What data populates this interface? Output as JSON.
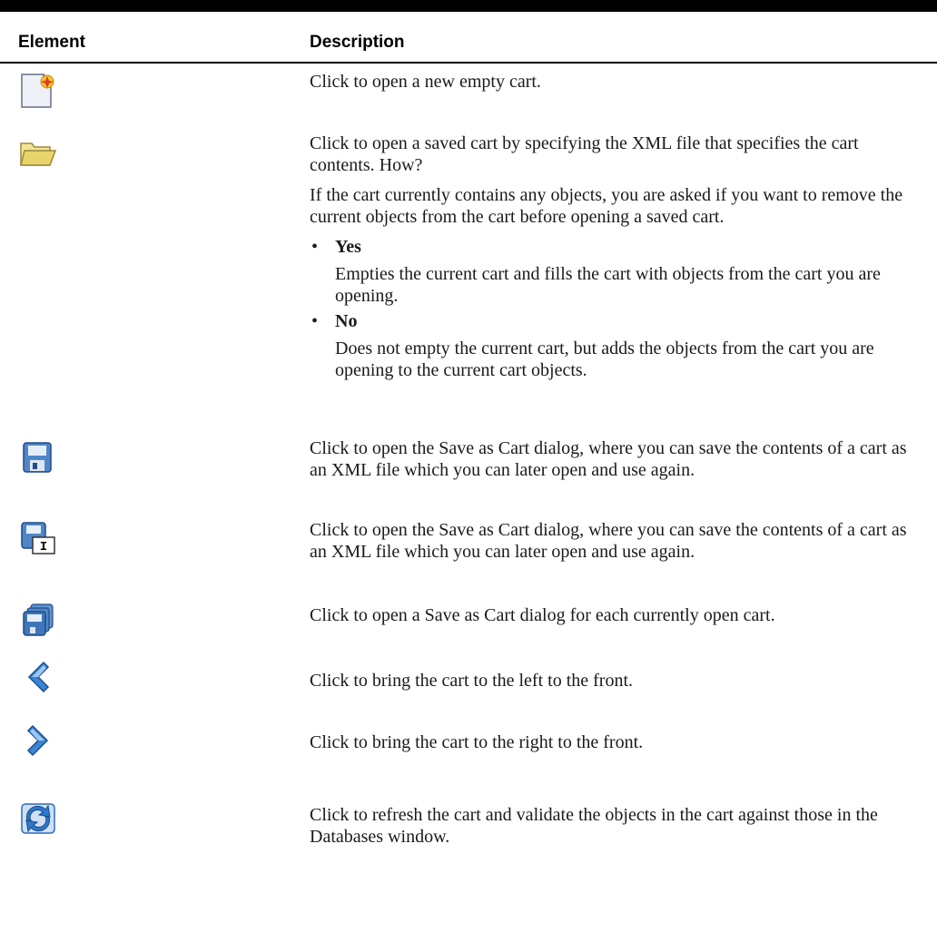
{
  "table": {
    "header": {
      "element": "Element",
      "description": "Description"
    },
    "rows": [
      {
        "icon": "new-cart-icon",
        "text": [
          "Click to open a new empty cart."
        ]
      },
      {
        "icon": "open-folder-icon",
        "text": [
          "Click to open a saved cart by specifying the XML file that specifies the cart contents. How?",
          "If the cart currently contains any objects, you are asked if you want to remove the current objects from the cart before opening a saved cart."
        ],
        "options": [
          {
            "term": "Yes",
            "desc": "Empties the current cart and fills the cart with objects from the cart you are opening."
          },
          {
            "term": "No",
            "desc": "Does not empty the current cart, but adds the objects from the cart you are opening to the current cart objects."
          }
        ]
      },
      {
        "icon": "save-icon",
        "text": [
          "Click to open the Save as Cart dialog, where you can save the contents of a cart as an XML file which you can later open and use again."
        ]
      },
      {
        "icon": "save-as-icon",
        "text": [
          "Click to open the Save as Cart dialog, where you can save the contents of a cart as an XML file which you can later open and use again."
        ]
      },
      {
        "icon": "save-all-icon",
        "text": [
          "Click to open a Save as Cart dialog for each currently open cart."
        ]
      },
      {
        "icon": "chevron-left-icon",
        "text": [
          "Click to bring the cart to the left to the front."
        ]
      },
      {
        "icon": "chevron-right-icon",
        "text": [
          "Click to bring the cart to the right to the front."
        ]
      },
      {
        "icon": "refresh-icon",
        "text": [
          "Click to refresh the cart and validate the objects in the cart against those in the Databases window."
        ]
      }
    ]
  },
  "colors": {
    "rule": "#000000",
    "text": "#1a1a1a",
    "icon_blue": "#2f6db5",
    "folder_yellow": "#e9d36a"
  }
}
